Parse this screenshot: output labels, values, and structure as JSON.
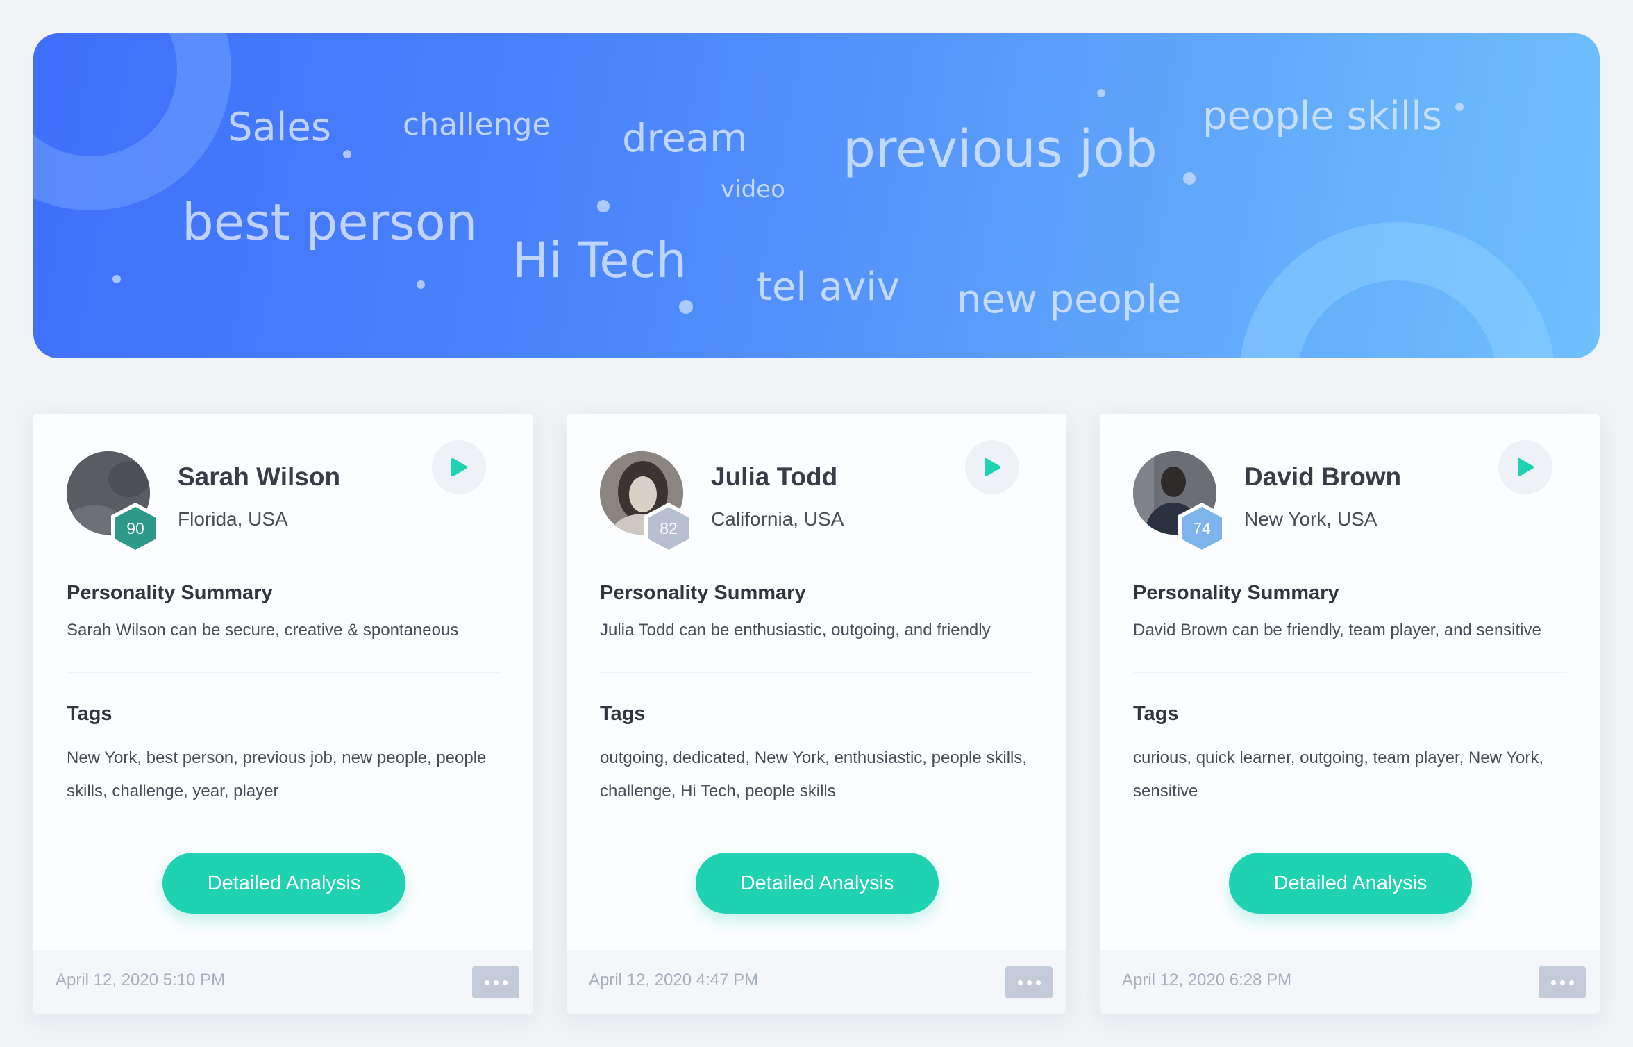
{
  "hero": {
    "words": [
      "Sales",
      "challenge",
      "dream",
      "previous job",
      "people skills",
      "video",
      "best person",
      "Hi Tech",
      "tel aviv",
      "new people"
    ]
  },
  "common": {
    "summary_heading": "Personality Summary",
    "tags_heading": "Tags",
    "analysis_label": "Detailed Analysis"
  },
  "profiles": [
    {
      "name": "Sarah Wilson",
      "location": "Florida, USA",
      "score": "90",
      "score_color": "#2c9a87",
      "summary": "Sarah Wilson can be secure, creative & spontaneous",
      "tags": "New York, best person, previous job, new people, people skills, challenge, year, player",
      "date": "April 12, 2020 5:10 PM"
    },
    {
      "name": "Julia Todd",
      "location": "California, USA",
      "score": "82",
      "score_color": "#b6c0d0",
      "summary": "Julia Todd can be enthusiastic, outgoing, and friendly",
      "tags": "outgoing, dedicated, New York, enthusiastic, people skills, challenge, Hi Tech, people skills",
      "date": "April 12, 2020 4:47 PM"
    },
    {
      "name": "David Brown",
      "location": "New York, USA",
      "score": "74",
      "score_color": "#7db4ec",
      "summary": "David Brown can be friendly, team player, and sensitive",
      "tags": "curious, quick learner, outgoing, team player, New York, sensitive",
      "date": "April 12, 2020 6:28 PM"
    }
  ],
  "colors": {
    "accent": "#1ed2b2",
    "hero_start": "#3f6ffb",
    "hero_end": "#6fc0fd"
  },
  "icons": [
    "play-icon",
    "more-dots-icon"
  ]
}
